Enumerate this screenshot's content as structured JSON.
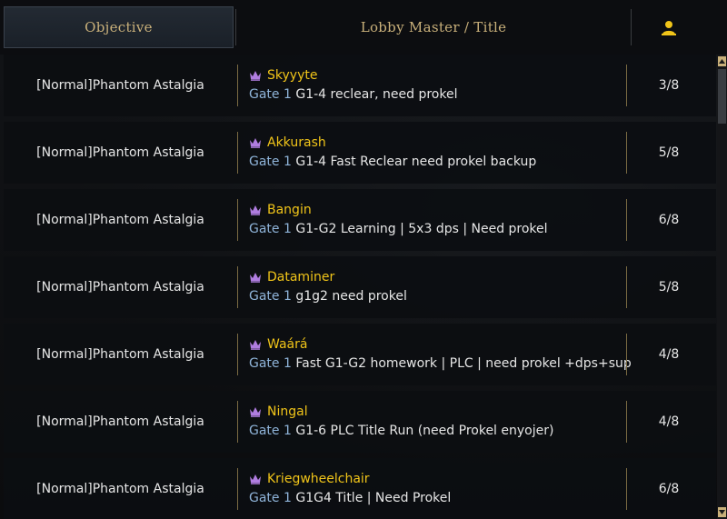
{
  "header": {
    "objective": "Objective",
    "lobby": "Lobby Master / Title",
    "players_icon": "person-icon"
  },
  "colors": {
    "accent_gold": "#c9b07a",
    "master_name": "#f0c419",
    "gate_label": "#8fb4d9",
    "crown": "#b07de0"
  },
  "rows": [
    {
      "objective": "[Normal]Phantom Astalgia",
      "master": "Skyyyte",
      "gate": "Gate 1",
      "title": "G1-4 reclear, need prokel",
      "count": "3/8"
    },
    {
      "objective": "[Normal]Phantom Astalgia",
      "master": "Akkurash",
      "gate": "Gate 1",
      "title": "G1-4 Fast Reclear need prokel backup",
      "count": "5/8"
    },
    {
      "objective": "[Normal]Phantom Astalgia",
      "master": "Bangin",
      "gate": "Gate 1",
      "title": "G1-G2 Learning | 5x3 dps | Need prokel",
      "count": "6/8"
    },
    {
      "objective": "[Normal]Phantom Astalgia",
      "master": "Dataminer",
      "gate": "Gate 1",
      "title": "g1g2 need prokel",
      "count": "5/8"
    },
    {
      "objective": "[Normal]Phantom Astalgia",
      "master": "Waárá",
      "gate": "Gate 1",
      "title": "Fast G1-G2 homework | PLC | need prokel +dps+sup",
      "count": "4/8"
    },
    {
      "objective": "[Normal]Phantom Astalgia",
      "master": "Ningal",
      "gate": "Gate 1",
      "title": "G1-6 PLC Title Run (need Prokel enyojer)",
      "count": "4/8"
    },
    {
      "objective": "[Normal]Phantom Astalgia",
      "master": "Kriegwheelchair",
      "gate": "Gate 1",
      "title": "G1G4 Title | Need Prokel",
      "count": "6/8"
    }
  ]
}
